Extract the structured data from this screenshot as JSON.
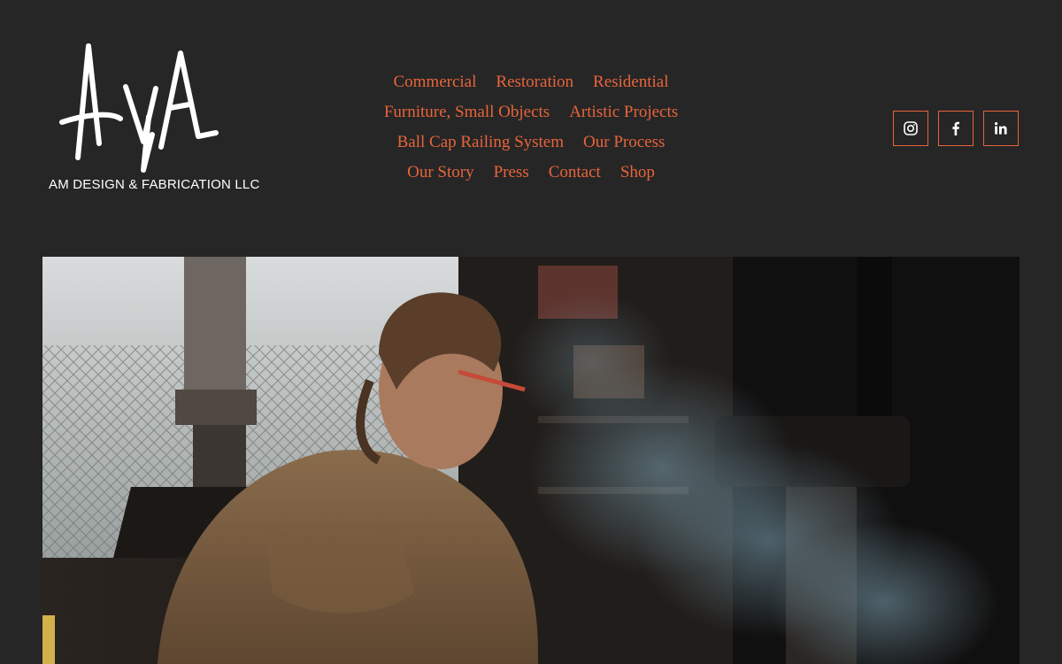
{
  "brand": {
    "company_name": "AM DESIGN & FABRICATION LLC",
    "logo_mark": "AMA"
  },
  "nav": {
    "rows": [
      [
        {
          "label": "Commercial"
        },
        {
          "label": "Restoration"
        },
        {
          "label": "Residential"
        }
      ],
      [
        {
          "label": "Furniture, Small Objects"
        },
        {
          "label": "Artistic Projects"
        }
      ],
      [
        {
          "label": "Ball Cap Railing System"
        },
        {
          "label": "Our Process"
        }
      ],
      [
        {
          "label": "Our Story"
        },
        {
          "label": "Press"
        },
        {
          "label": "Contact"
        },
        {
          "label": "Shop"
        }
      ]
    ]
  },
  "social": [
    {
      "icon": "instagram-icon"
    },
    {
      "icon": "facebook-icon"
    },
    {
      "icon": "linkedin-icon"
    }
  ],
  "colors": {
    "background": "#262626",
    "accent": "#e8643b",
    "logo": "#ffffff"
  }
}
